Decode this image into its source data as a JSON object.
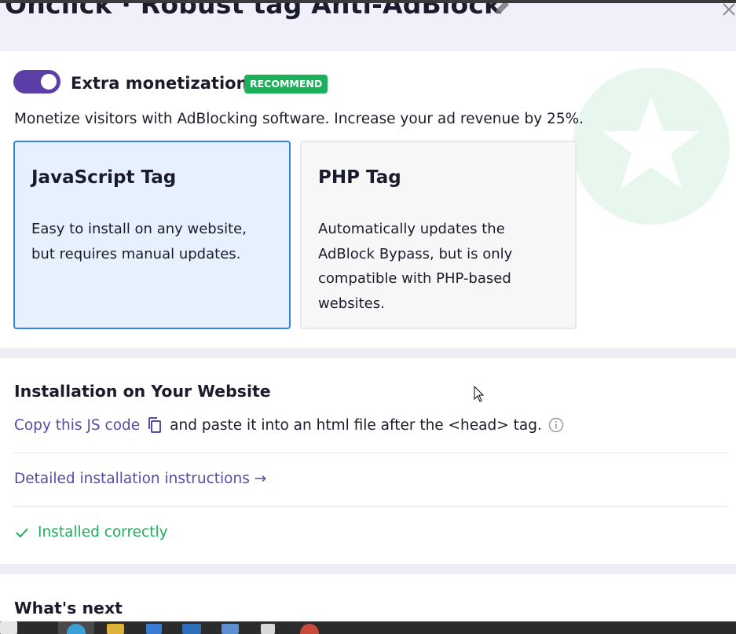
{
  "header": {
    "title": "Onclick · Robust tag Anti-AdBlock",
    "edit_icon": "pencil-icon",
    "close_icon": "close-icon"
  },
  "monetization": {
    "toggle_on": true,
    "title": "Extra monetization",
    "badge": "RECOMMEND",
    "description": "Monetize visitors with AdBlocking software. Increase your ad revenue by 25%.",
    "decoration_icon": "star-icon",
    "options": [
      {
        "title": "JavaScript Tag",
        "description": "Easy to install on any website, but requires manual updates.",
        "selected": true
      },
      {
        "title": "PHP Tag",
        "description": "Automatically updates the AdBlock Bypass, but is only compatible with PHP-based websites.",
        "selected": false
      }
    ]
  },
  "installation": {
    "title": "Installation on Your Website",
    "copy_link": "Copy this JS code",
    "copy_icon": "copy-icon",
    "instruction": "and paste it into an html file after the <head> tag.",
    "info_icon": "info-icon",
    "detail_link": "Detailed installation instructions →",
    "status": "Installed correctly",
    "status_icon": "check-icon"
  },
  "next": {
    "title": "What's next"
  },
  "colors": {
    "accent": "#5b3ea8",
    "link": "#5a49a8",
    "success": "#1bb15b",
    "selected_border": "#3584e4",
    "selected_bg": "#e7f0fd"
  }
}
